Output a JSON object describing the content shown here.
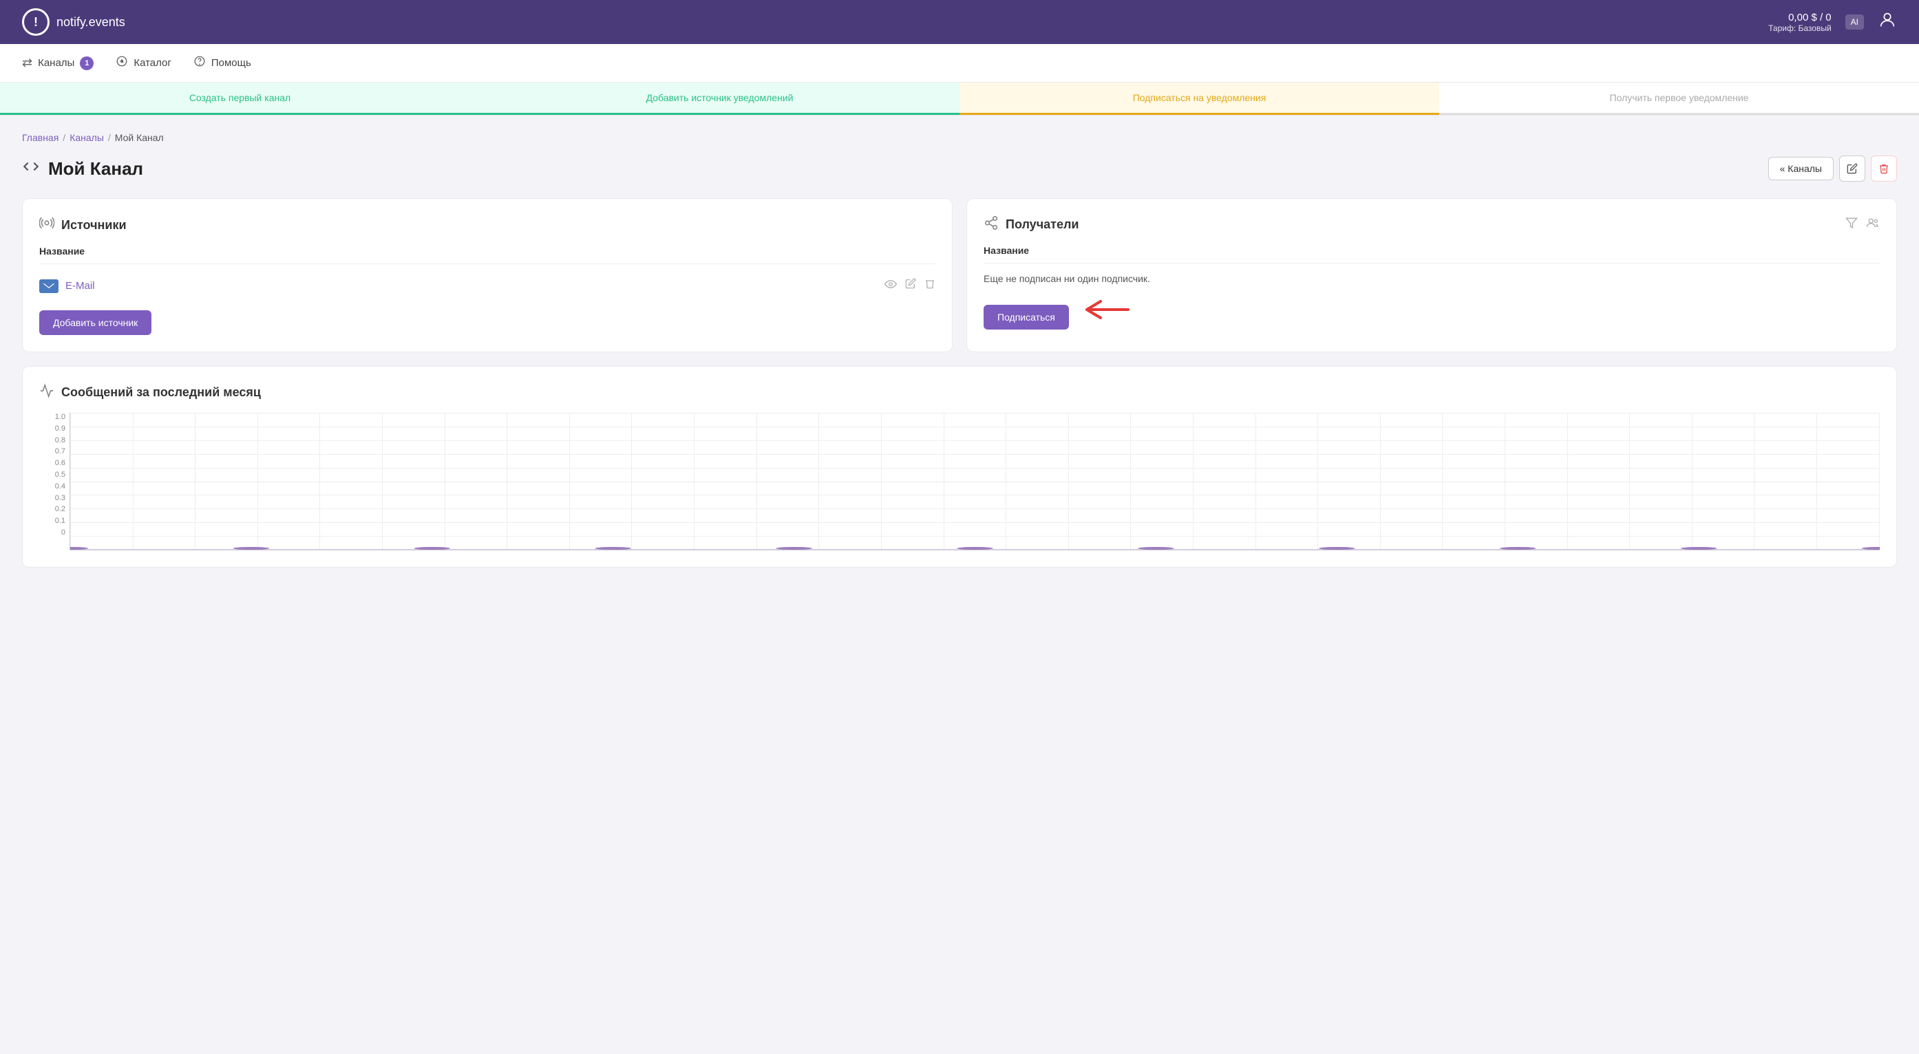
{
  "header": {
    "logo_text": "notify.events",
    "logo_icon": "!",
    "balance": "0,00 $ / 0",
    "plan_label": "Тариф: Базовый",
    "lang": "AI",
    "user_icon": "👤"
  },
  "nav": {
    "channels_label": "Каналы",
    "channels_badge": "1",
    "catalog_label": "Каталог",
    "help_label": "Помощь"
  },
  "steps": [
    {
      "label": "Создать первый канал",
      "state": "done"
    },
    {
      "label": "Добавить источник уведомлений",
      "state": "done"
    },
    {
      "label": "Подписаться на уведомления",
      "state": "active"
    },
    {
      "label": "Получить первое уведомление",
      "state": "inactive"
    }
  ],
  "breadcrumb": {
    "home": "Главная",
    "channels": "Каналы",
    "current": "Мой Канал",
    "sep": "/"
  },
  "page_title": "Мой Канал",
  "title_actions": {
    "back_label": "« Каналы",
    "edit_icon": "✎",
    "delete_icon": "🗑"
  },
  "sources_card": {
    "title": "Источники",
    "icon": "📡",
    "table_header": "Название",
    "source": {
      "name": "E-Mail",
      "icon": "✉"
    },
    "action_icons": {
      "view": "👁",
      "edit": "✎",
      "delete": "🗑"
    },
    "add_button": "Добавить источник"
  },
  "recipients_card": {
    "title": "Получатели",
    "icon": "🔗",
    "table_header": "Название",
    "filter_icon": "⚗",
    "group_icon": "👥",
    "no_subscribers": "Еще не подписан ни один подписчик.",
    "subscribe_button": "Подписаться"
  },
  "chart": {
    "title": "Сообщений за последний месяц",
    "icon": "📈",
    "y_labels": [
      "1.0",
      "0.9",
      "0.8",
      "0.7",
      "0.6",
      "0.5",
      "0.4",
      "0.3",
      "0.2",
      "0.1",
      "0"
    ],
    "data_points": [
      0,
      0,
      0,
      0,
      0,
      0,
      0,
      0,
      0,
      0,
      0,
      0,
      0,
      0,
      0,
      0,
      0,
      0,
      0,
      0,
      0,
      0,
      0,
      0,
      0,
      0,
      0,
      0,
      0,
      0
    ]
  }
}
